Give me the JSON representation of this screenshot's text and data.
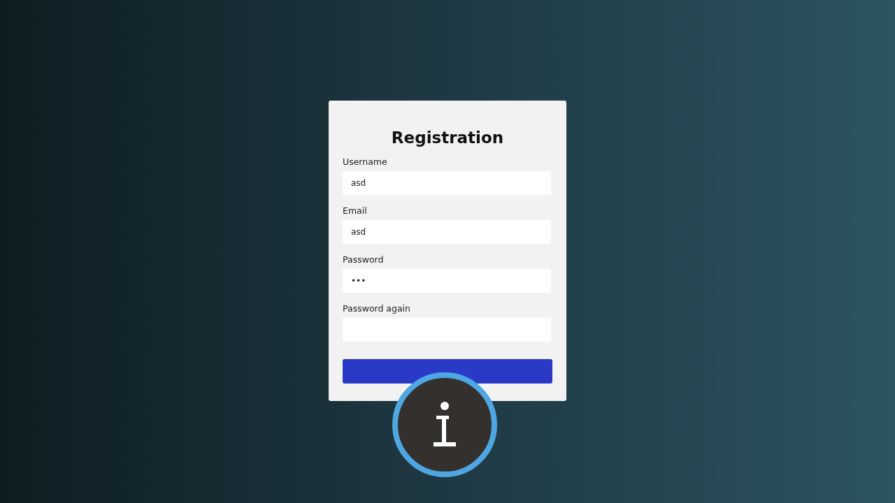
{
  "form": {
    "title": "Registration",
    "fields": [
      {
        "label": "Username",
        "value": "asd"
      },
      {
        "label": "Email",
        "value": "asd"
      },
      {
        "label": "Password",
        "value": "•••"
      },
      {
        "label": "Password again"
      }
    ]
  }
}
